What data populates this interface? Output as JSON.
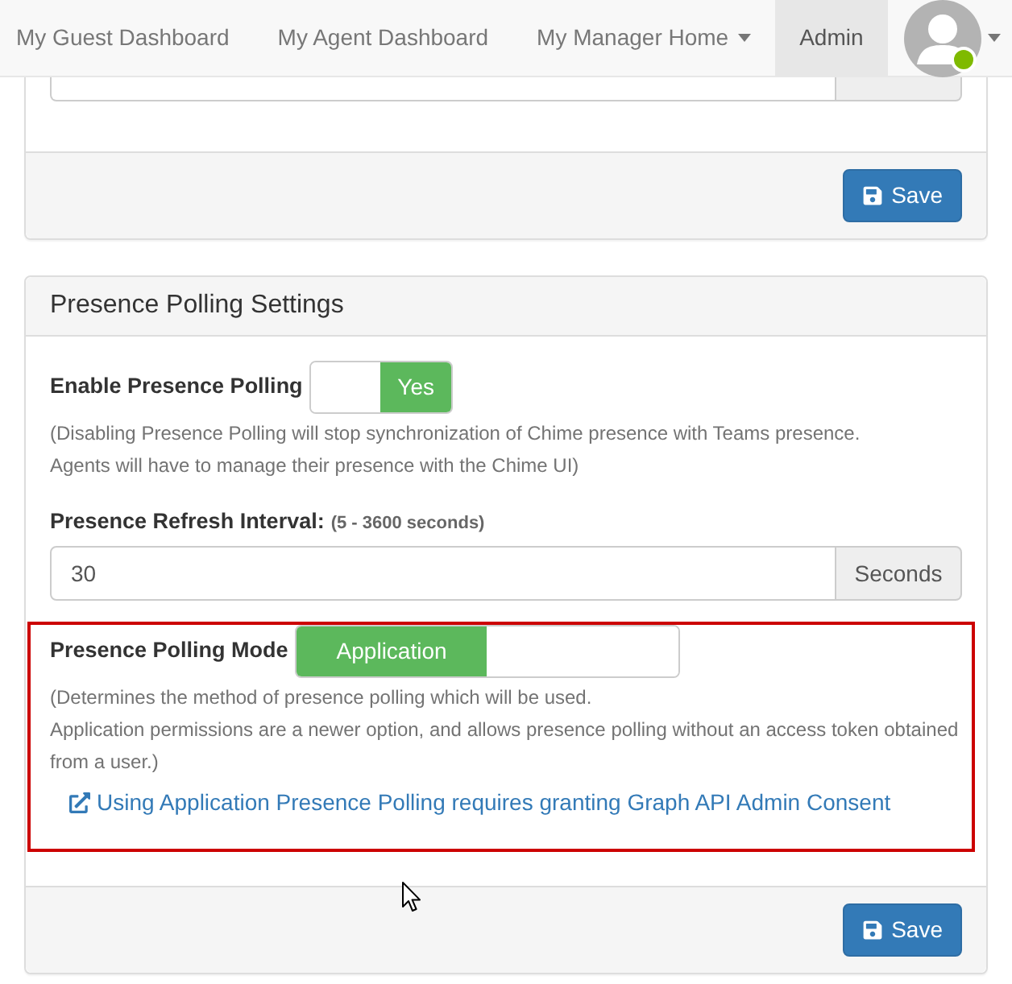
{
  "navbar": {
    "items": [
      {
        "label": "My Guest Dashboard",
        "selected": false,
        "dropdown": false
      },
      {
        "label": "My Agent Dashboard",
        "selected": false,
        "dropdown": false
      },
      {
        "label": "My Manager Home",
        "selected": false,
        "dropdown": true
      },
      {
        "label": "Admin",
        "selected": true,
        "dropdown": false
      }
    ],
    "user_menu": {
      "online": true
    }
  },
  "panels": [
    {
      "fields": [
        {
          "kind": "clipped_input"
        }
      ],
      "save_button": "Save"
    },
    {
      "heading": "Presence Polling Settings",
      "fields": [
        {
          "kind": "switch",
          "label": "Enable Presence Polling",
          "on": true,
          "on_text": "Yes",
          "help": [
            "(Disabling Presence Polling will stop synchronization of Chime presence with Teams presence.",
            "Agents will have to manage their presence with the Chime UI)"
          ]
        },
        {
          "kind": "input",
          "label": "Presence Refresh Interval:",
          "hint": "(5 - 3600 seconds)",
          "value": "30",
          "addon": "Seconds"
        },
        {
          "kind": "option_switch",
          "label": "Presence Polling Mode",
          "highlighted": true,
          "on": true,
          "on_text": "Application",
          "help": [
            "(Determines the method of presence polling which will be used.",
            "Application permissions are a newer option, and allows presence polling without an access token obtained from a user.)"
          ],
          "link": "Using Application Presence Polling requires granting Graph API Admin Consent"
        }
      ],
      "save_button": "Save"
    }
  ]
}
